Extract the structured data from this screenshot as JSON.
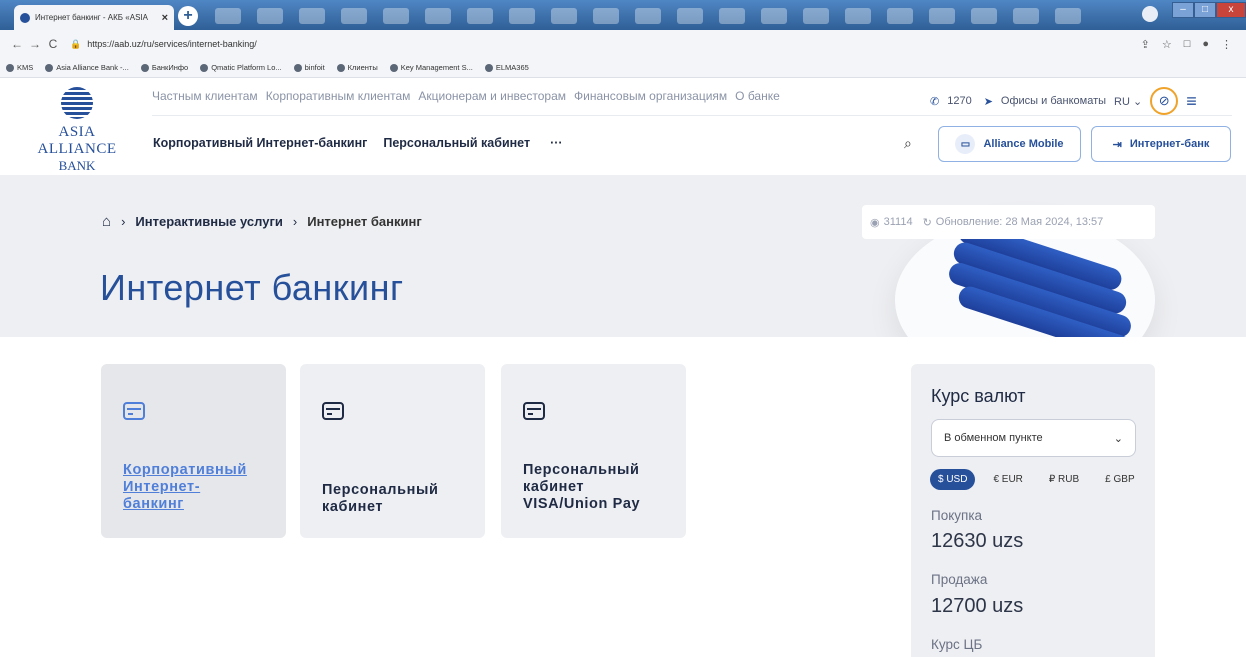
{
  "browser": {
    "tab_title": "Интернет банкинг - АКБ «ASIA",
    "tab_close": "×",
    "new_tab": "+",
    "url": "https://aab.uz/ru/services/internet-banking/",
    "bookmarks": [
      "KMS",
      "Asia Alliance Bank -...",
      "БанкИнфо",
      "Qmatic Platform Lo...",
      "binfoit",
      "Клиенты",
      "Key Management S...",
      "ELMA365"
    ]
  },
  "header": {
    "logo_line1": "ASIA ALLIANCE",
    "logo_line2": "BANK",
    "top_nav": [
      "Частным клиентам",
      "Корпоративным клиентам",
      "Акционерам и инвесторам",
      "Финансовым организациям",
      "О банке"
    ],
    "phone": "1270",
    "offices": "Офисы и банкоматы",
    "lang": "RU",
    "main_nav": [
      "Корпоративный Интернет-банкинг",
      "Персональный кабинет",
      "···"
    ],
    "btn_mobile": "Alliance Mobile",
    "btn_internet": "Интернет-банк"
  },
  "hero": {
    "breadcrumb": [
      "Интерактивные услуги",
      "Интернет банкинг"
    ],
    "title": "Интернет банкинг",
    "views": "31114",
    "updated": "Обновление: 28 Мая 2024, 13:57"
  },
  "cards": [
    {
      "title": "Корпоративный Интернет-банкинг",
      "lines": [
        "Корпоративный",
        "Интернет-",
        "банкинг"
      ]
    },
    {
      "title": "Персональный кабинет",
      "lines": [
        "Персональный",
        "кабинет"
      ]
    },
    {
      "title": "Персональный кабинет VISA/Union Pay",
      "lines": [
        "Персональный",
        "кабинет",
        "VISA/Union Pay"
      ]
    }
  ],
  "fx": {
    "title": "Курс валют",
    "select_value": "В обменном пункте",
    "tabs": [
      "$ USD",
      "€ EUR",
      "₽ RUB",
      "£ GBP"
    ],
    "buy_label": "Покупка",
    "buy_value": "12630 uzs",
    "sell_label": "Продажа",
    "sell_value": "12700 uzs",
    "cb_label": "Курс ЦБ"
  }
}
